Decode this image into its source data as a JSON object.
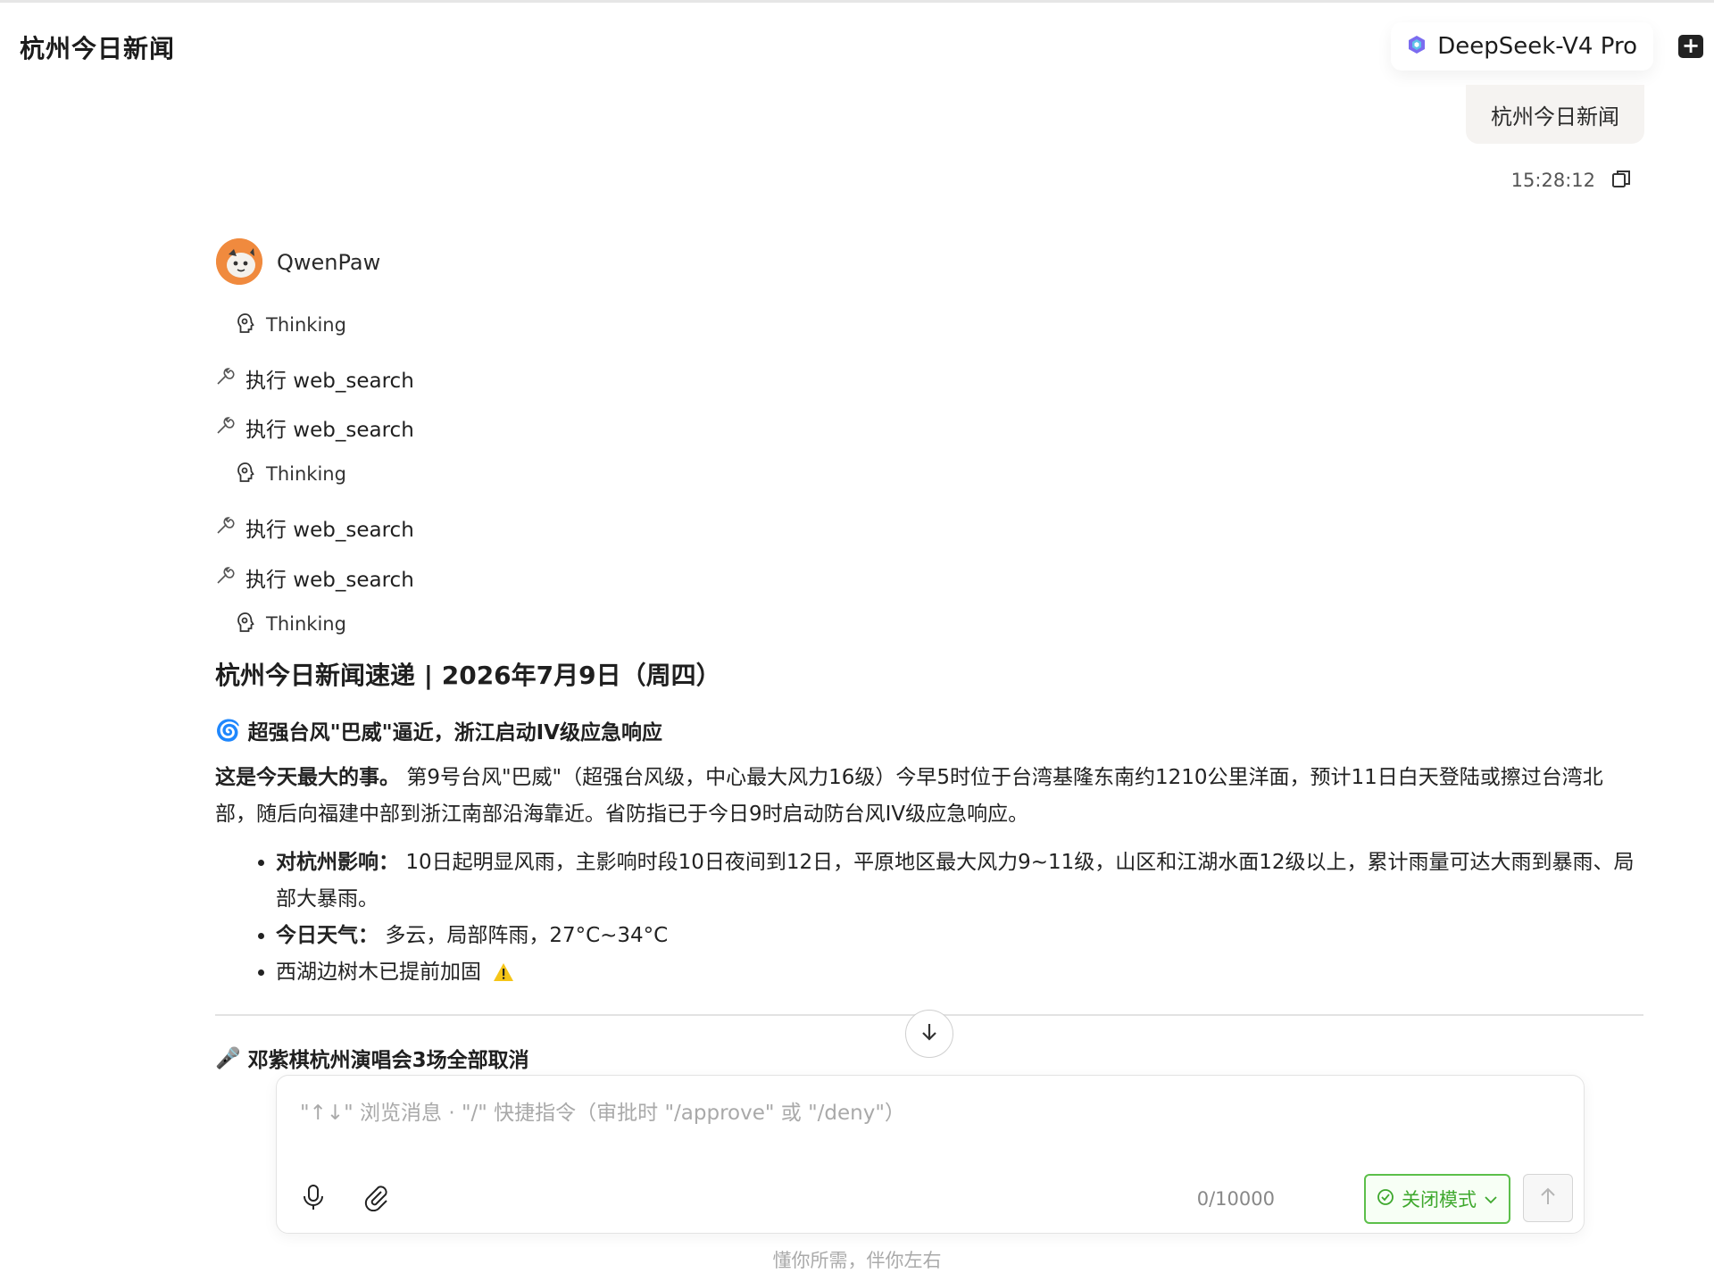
{
  "header": {
    "title": "杭州今日新闻",
    "model_name": "DeepSeek-V4 Pro",
    "new_chat_icon": "plus-chat-icon"
  },
  "user_message": {
    "text": "杭州今日新闻",
    "timestamp": "15:28:12"
  },
  "assistant": {
    "name": "QwenPaw",
    "steps": [
      {
        "type": "thinking",
        "label": "Thinking",
        "icon": "brain-icon"
      },
      {
        "type": "tool",
        "label": "执行 web_search",
        "icon": "wrench-icon"
      },
      {
        "type": "tool",
        "label": "执行 web_search",
        "icon": "wrench-icon"
      },
      {
        "type": "thinking",
        "label": "Thinking",
        "icon": "brain-icon"
      },
      {
        "type": "tool",
        "label": "执行 web_search",
        "icon": "wrench-icon"
      },
      {
        "type": "tool",
        "label": "执行 web_search",
        "icon": "wrench-icon"
      },
      {
        "type": "thinking",
        "label": "Thinking",
        "icon": "brain-icon"
      }
    ],
    "article": {
      "heading": "杭州今日新闻速递 | 2026年7月9日（周四）",
      "section1_icon": "🌀",
      "section1_title": "超强台风\"巴威\"逼近，浙江启动IV级应急响应",
      "intro_bold": "这是今天最大的事。",
      "intro_text": "第9号台风\"巴威\"（超强台风级，中心最大风力16级）今早5时位于台湾基隆东南约1210公里洋面，预计11日白天登陆或擦过台湾北部，随后向福建中部到浙江南部沿海靠近。省防指已于今日9时启动防台风IV级应急响应。",
      "bullets": [
        {
          "bold": "对杭州影响：",
          "text": "10日起明显风雨，主影响时段10日夜间到12日，平原地区最大风力9~11级，山区和江湖水面12级以上，累计雨量可达大雨到暴雨、局部大暴雨。"
        },
        {
          "bold": "今日天气：",
          "text": "多云，局部阵雨，27°C~34°C"
        },
        {
          "bold": "",
          "text": "西湖边树木已提前加固"
        }
      ],
      "section2_icon": "🎤",
      "section2_title": "邓紫棋杭州演唱会3场全部取消"
    }
  },
  "composer": {
    "placeholder": "\"↑↓\" 浏览消息 · \"/\" 快捷指令（审批时 \"/approve\" 或 \"/deny\"）",
    "counter": "0/10000",
    "mode_label": "关闭模式",
    "accent": "#5cbf4a"
  },
  "footer": {
    "text": "懂你所需，伴你左右"
  }
}
